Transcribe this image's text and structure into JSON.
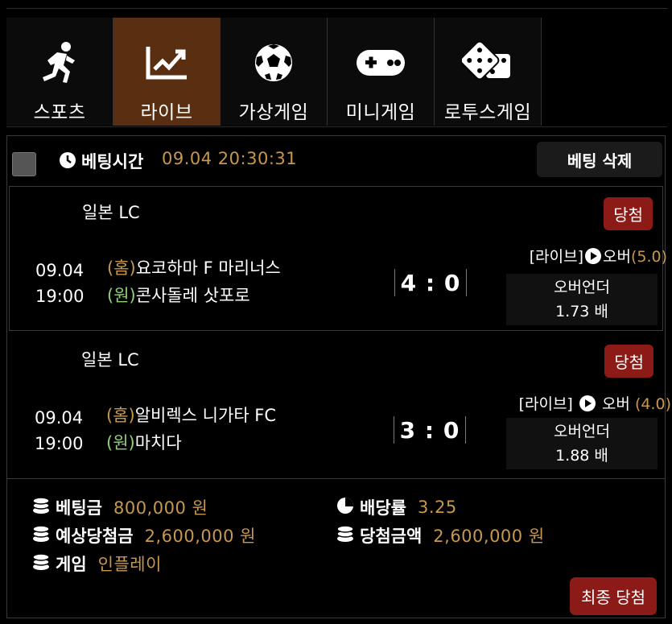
{
  "tabs": [
    {
      "label": "스포츠",
      "icon": "running-person-icon"
    },
    {
      "label": "라이브",
      "icon": "line-chart-icon",
      "active": true
    },
    {
      "label": "가상게임",
      "icon": "soccer-ball-icon"
    },
    {
      "label": "미니게임",
      "icon": "gamepad-icon"
    },
    {
      "label": "로투스게임",
      "icon": "dice-icon"
    }
  ],
  "bet": {
    "time_label": "베팅시간",
    "time_value": "09.04 20:30:31",
    "delete_label": "베팅 삭제",
    "games": [
      {
        "league": "일본 LC",
        "result": "당첨",
        "date": "09.04",
        "time": "19:00",
        "home_tag": "(홈)",
        "home": "요코하마 F 마리너스",
        "away_tag": "(원)",
        "away": "콘사돌레 삿포로",
        "score": "4 : 0",
        "market_prefix": "[라이브]",
        "market_pick": "오버",
        "market_line": "(5.0)",
        "bet_type": "오버언더",
        "odds": "1.73 배"
      },
      {
        "league": "일본 LC",
        "result": "당첨",
        "date": "09.04",
        "time": "19:00",
        "home_tag": "(홈)",
        "home": "알비렉스 니가타 FC",
        "away_tag": "(원)",
        "away": "마치다",
        "score": "3 : 0",
        "market_prefix": "[라이브]",
        "market_pick": "오버",
        "market_line": "(4.0)",
        "bet_type": "오버언더",
        "odds": "1.88 배"
      }
    ],
    "summary": {
      "stake_label": "베팅금",
      "stake_value": "800,000 원",
      "rate_label": "배당률",
      "rate_value": "3.25",
      "expected_label": "예상당첨금",
      "expected_value": "2,600,000 원",
      "won_label": "당첨금액",
      "won_value": "2,600,000 원",
      "game_label": "게임",
      "game_value": "인플레이"
    },
    "final_label": "최종 당첨"
  },
  "colors": {
    "accent": "#c8974f",
    "active_tab": "#5a2e10",
    "badge": "#8c1a16",
    "home": "#c8974f",
    "away": "#8fd07a"
  }
}
